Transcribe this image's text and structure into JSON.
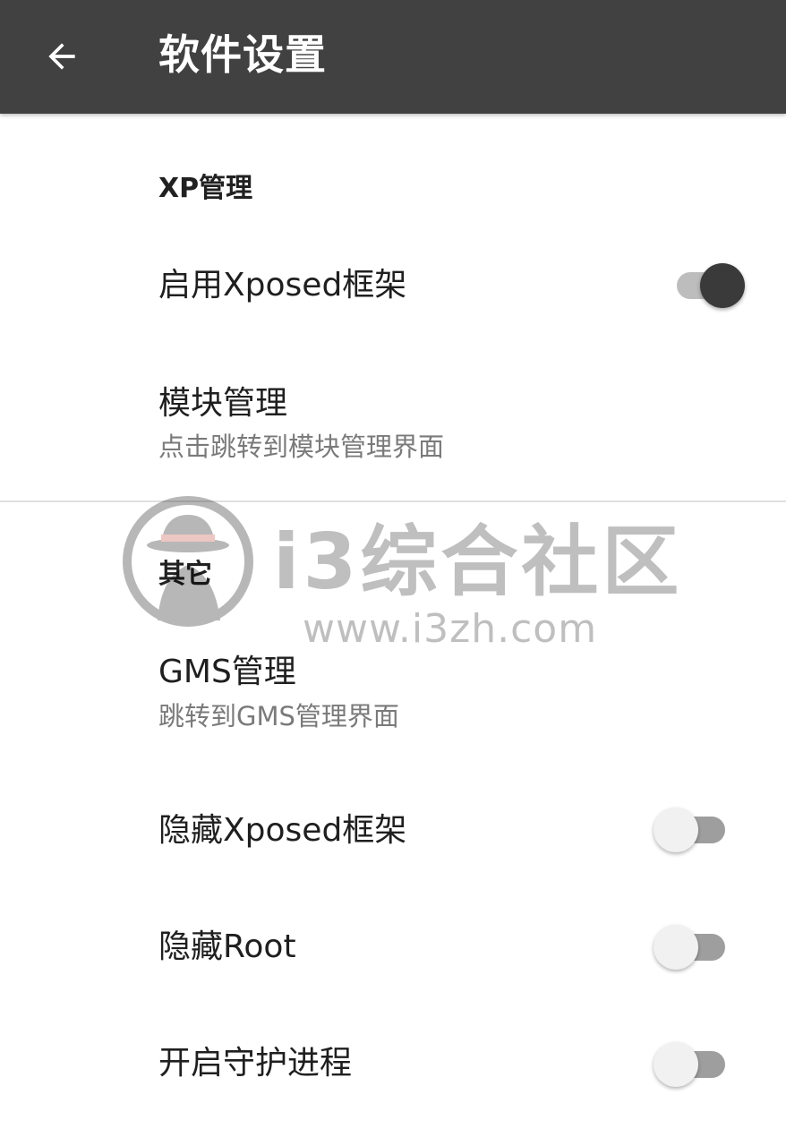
{
  "appbar": {
    "title": "软件设置",
    "back_icon": "arrow-left-icon"
  },
  "sections": {
    "xp": {
      "header": "XP管理",
      "enable_xposed": {
        "title": "启用Xposed框架",
        "checked": true
      },
      "module_manage": {
        "title": "模块管理",
        "summary": "点击跳转到模块管理界面"
      }
    },
    "other": {
      "header": "其它",
      "gms_manage": {
        "title": "GMS管理",
        "summary": "跳转到GMS管理界面"
      },
      "hide_xposed": {
        "title": "隐藏Xposed框架",
        "checked": false
      },
      "hide_root": {
        "title": "隐藏Root",
        "checked": false
      },
      "daemon": {
        "title": "开启守护进程",
        "checked": false
      }
    }
  },
  "watermark": {
    "name": "i3综合社区",
    "url": "www.i3zh.com"
  },
  "colors": {
    "appbar_bg": "#414141",
    "switch_on_thumb": "#3a3a3a",
    "switch_off_thumb": "#f1f1f1"
  }
}
